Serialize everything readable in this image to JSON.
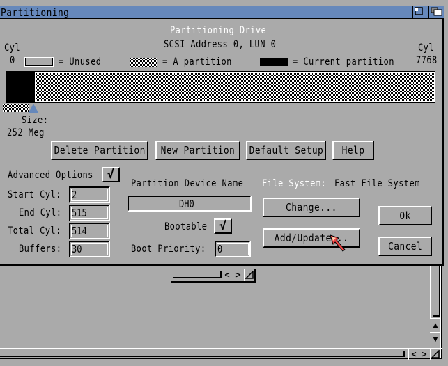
{
  "window": {
    "title": "Partitioning",
    "gadgets": [
      "zoom-gadget",
      "depth-gadget"
    ]
  },
  "header": {
    "title": "Partitioning Drive",
    "subtitle": "SCSI Address 0, LUN 0",
    "cyl_left_label": "Cyl",
    "cyl_left_value": "0",
    "cyl_right_label": "Cyl",
    "cyl_right_value": "7768"
  },
  "legend": {
    "unused": "= Unused",
    "a_partition": "= A partition",
    "current_partition": "= Current partition"
  },
  "partition_map": {
    "total_cylinders": 7768,
    "current_partition": {
      "start": 2,
      "end": 515
    },
    "other_partition": {
      "start": 516,
      "end": 7768
    }
  },
  "size": {
    "label": "Size:",
    "value": "252 Meg"
  },
  "buttons": {
    "delete_partition": "Delete Partition",
    "new_partition": "New Partition",
    "default_setup": "Default Setup",
    "help": "Help",
    "change": "Change...",
    "add_update": "Add/Update...",
    "ok": "Ok",
    "cancel": "Cancel"
  },
  "advanced": {
    "label": "Advanced Options",
    "checked": "√"
  },
  "fields": {
    "start_cyl_label": "Start Cyl:",
    "start_cyl_value": "2",
    "end_cyl_label": "End Cyl:",
    "end_cyl_value": "515",
    "total_cyl_label": "Total Cyl:",
    "total_cyl_value": "514",
    "buffers_label": "Buffers:",
    "buffers_value": "30"
  },
  "device": {
    "label": "Partition Device Name",
    "value": "DH0",
    "bootable_label": "Bootable",
    "bootable_checked": "√",
    "boot_priority_label": "Boot Priority:",
    "boot_priority_value": "0"
  },
  "filesystem": {
    "label": "File System:",
    "value": "Fast File System"
  },
  "scroll": {
    "left": "<",
    "right": ">",
    "up": "^",
    "down": "v"
  },
  "colors": {
    "background": "#aaaaaa",
    "titlebar": "#6688bb",
    "pointer": "#ee4444"
  }
}
